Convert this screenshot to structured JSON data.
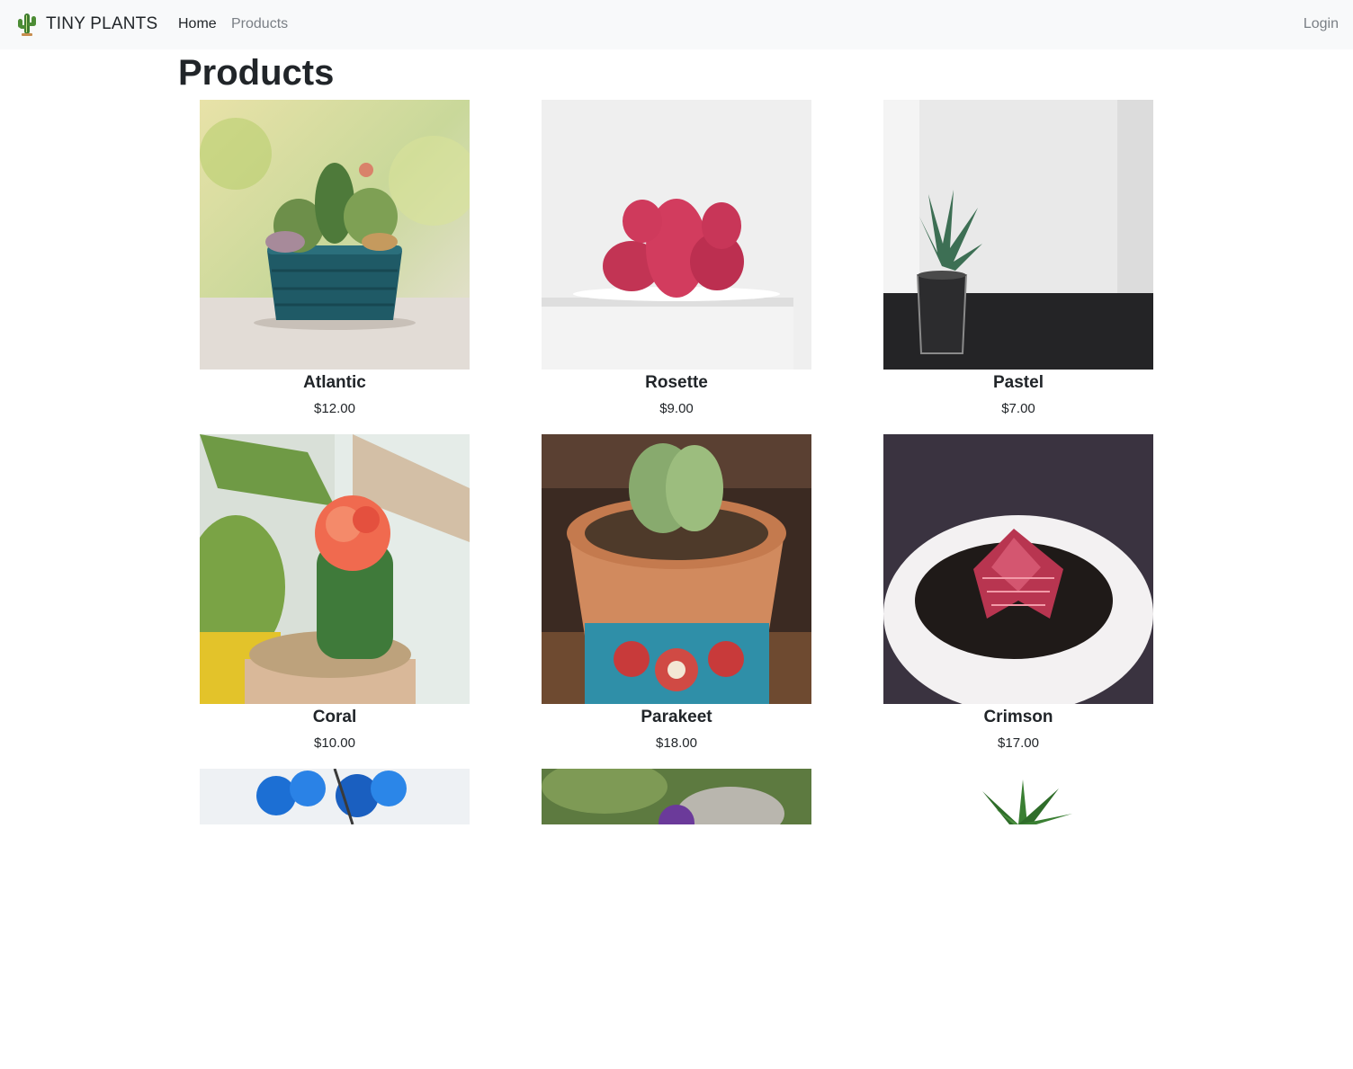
{
  "navbar": {
    "brand_name": "TINY PLANTS",
    "brand_icon": "cactus-icon",
    "links": {
      "home": "Home",
      "products": "Products"
    },
    "login": "Login"
  },
  "page": {
    "title": "Products"
  },
  "products": [
    {
      "name": "Atlantic",
      "price": "$12.00",
      "image": "succulent-arrangement-teal-pot"
    },
    {
      "name": "Rosette",
      "price": "$9.00",
      "image": "pink-cactus-white-pot"
    },
    {
      "name": "Pastel",
      "price": "$7.00",
      "image": "aloe-glass-pot"
    },
    {
      "name": "Coral",
      "price": "$10.00",
      "image": "grafted-red-cactus"
    },
    {
      "name": "Parakeet",
      "price": "$18.00",
      "image": "lithops-terracotta-pot"
    },
    {
      "name": "Crimson",
      "price": "$17.00",
      "image": "red-crassula-white-pot"
    },
    {
      "name": "",
      "price": "",
      "image": "blue-orchid"
    },
    {
      "name": "",
      "price": "",
      "image": "purple-flowers-rock"
    },
    {
      "name": "",
      "price": "",
      "image": "spiky-green-plant"
    }
  ]
}
